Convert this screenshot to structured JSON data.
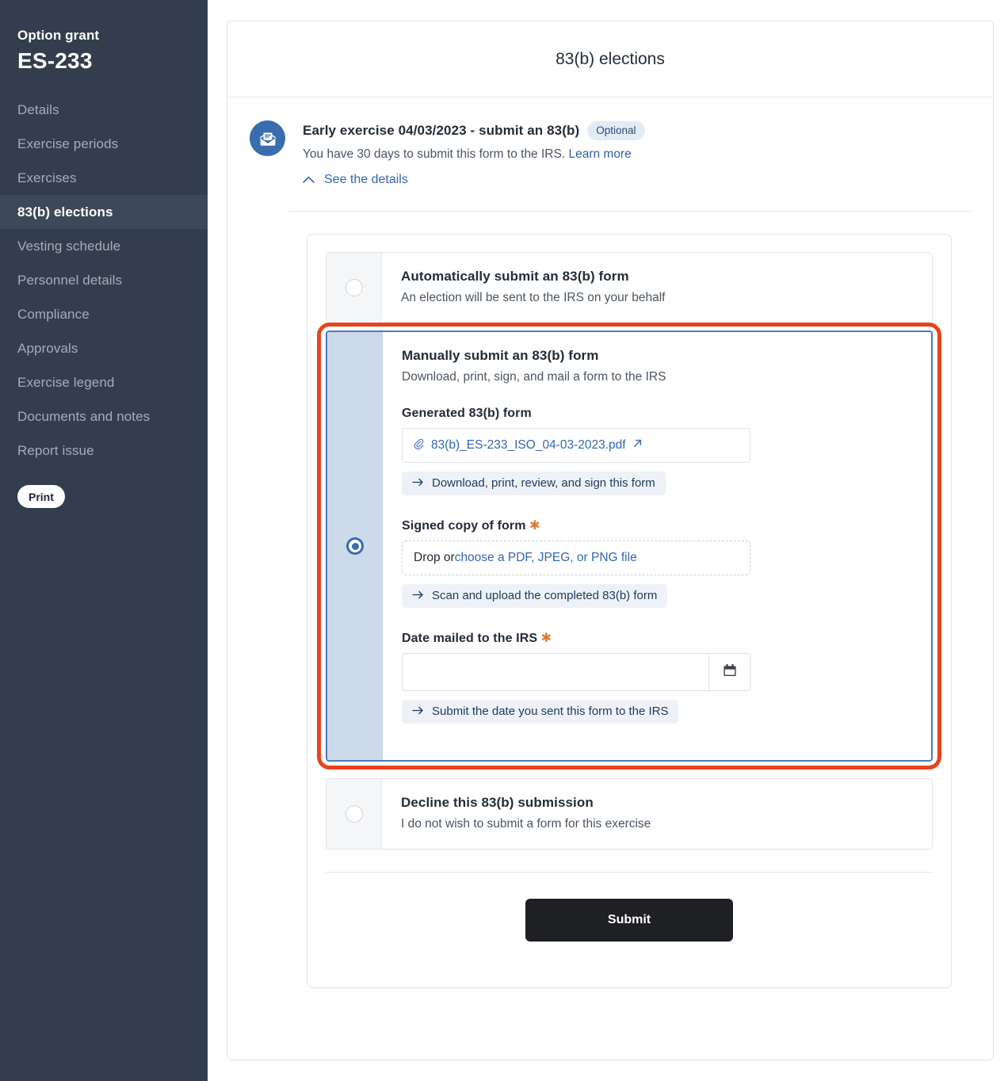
{
  "sidebar": {
    "eyebrow": "Option grant",
    "title": "ES-233",
    "items": [
      {
        "label": "Details",
        "active": false
      },
      {
        "label": "Exercise periods",
        "active": false
      },
      {
        "label": "Exercises",
        "active": false
      },
      {
        "label": "83(b) elections",
        "active": true
      },
      {
        "label": "Vesting schedule",
        "active": false
      },
      {
        "label": "Personnel details",
        "active": false
      },
      {
        "label": "Compliance",
        "active": false
      },
      {
        "label": "Approvals",
        "active": false
      },
      {
        "label": "Exercise legend",
        "active": false
      },
      {
        "label": "Documents and notes",
        "active": false
      },
      {
        "label": "Report issue",
        "active": false
      }
    ],
    "print_label": "Print"
  },
  "page": {
    "title": "83(b) elections"
  },
  "alert": {
    "icon": "envelope-document-icon",
    "title": "Early exercise 04/03/2023 - submit an 83(b)",
    "badge": "Optional",
    "subtitle_text": "You have 30 days to submit this form to the IRS.",
    "subtitle_link": "Learn more",
    "toggle_label": "See the details",
    "toggle_icon": "chevron-up-icon"
  },
  "options": [
    {
      "id": "automatic",
      "selected": false,
      "title": "Automatically submit an 83(b) form",
      "subtitle": "An election will be sent to the IRS on your behalf"
    },
    {
      "id": "manual",
      "selected": true,
      "highlighted": true,
      "title": "Manually submit an 83(b) form",
      "subtitle": "Download, print, sign, and mail a form to the IRS"
    },
    {
      "id": "decline",
      "selected": false,
      "title": "Decline this 83(b) submission",
      "subtitle": "I do not wish to submit a form for this exercise"
    }
  ],
  "manual_form": {
    "generated": {
      "label": "Generated 83(b) form",
      "file_icon": "paperclip-icon",
      "file_name": "83(b)_ES-233_ISO_04-03-2023.pdf",
      "external_icon": "external-link-icon",
      "hint_icon": "arrow-right-icon",
      "hint": "Download, print, review, and sign this form"
    },
    "signed": {
      "label": "Signed copy of form",
      "required_mark": "✱",
      "drop_prefix": "Drop or ",
      "drop_link": "choose a PDF, JPEG, or PNG file",
      "hint_icon": "arrow-right-icon",
      "hint": "Scan and upload the completed 83(b) form"
    },
    "date": {
      "label": "Date mailed to the IRS",
      "required_mark": "✱",
      "value": "",
      "placeholder": "",
      "calendar_icon": "calendar-icon",
      "hint_icon": "arrow-right-icon",
      "hint": "Submit the date you sent this form to the IRS"
    }
  },
  "footer": {
    "submit_label": "Submit"
  },
  "colors": {
    "sidebar_bg": "#333d4d",
    "sidebar_active_bg": "#3d4858",
    "accent_blue": "#3a6cb0",
    "link_blue": "#3366b5",
    "highlight_red": "#e8431f",
    "selected_col_bg": "#ccdae9",
    "required_orange": "#e07a37",
    "submit_bg": "#1f2023"
  }
}
